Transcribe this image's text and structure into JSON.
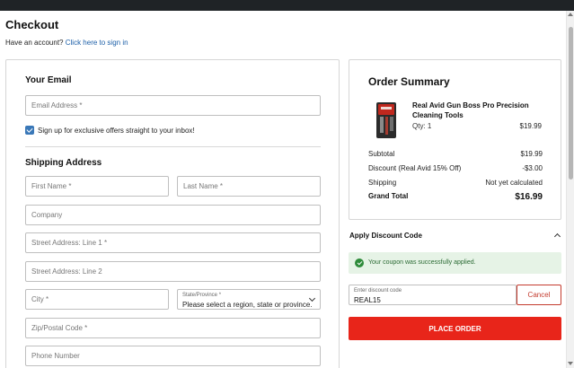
{
  "page": {
    "title": "Checkout",
    "account_prompt": "Have an account?",
    "sign_in_link": "Click here to sign in"
  },
  "email_section": {
    "title": "Your Email",
    "email_placeholder": "Email Address *",
    "signup_label": "Sign up for exclusive offers straight to your inbox!",
    "signup_checked": true
  },
  "shipping": {
    "title": "Shipping Address",
    "first_name": "First Name *",
    "last_name": "Last Name *",
    "company": "Company",
    "street1": "Street Address: Line 1 *",
    "street2": "Street Address: Line 2",
    "city": "City *",
    "state_label": "State/Province *",
    "state_value": "Please select a region, state or province.",
    "zip": "Zip/Postal Code *",
    "phone": "Phone Number"
  },
  "summary": {
    "title": "Order Summary",
    "product_name": "Real Avid Gun Boss Pro Precision Cleaning Tools",
    "product_qty": "Qty: 1",
    "product_price": "$19.99",
    "rows": [
      {
        "label": "Subtotal",
        "value": "$19.99"
      },
      {
        "label": "Discount (Real Avid 15% Off)",
        "value": "-$3.00"
      },
      {
        "label": "Shipping",
        "value": "Not yet calculated"
      },
      {
        "label": "Grand Total",
        "value": "$16.99"
      }
    ]
  },
  "discount": {
    "title": "Apply Discount Code",
    "success_message": "Your coupon was successfully applied.",
    "input_label": "Enter discount code",
    "input_value": "REAL15",
    "cancel_label": "Cancel"
  },
  "place_order_label": "PLACE ORDER",
  "colors": {
    "accent_red": "#e8251a",
    "link_blue": "#1c5fa8",
    "success_green": "#2e8b3a",
    "checkbox_blue": "#3a78b8"
  }
}
